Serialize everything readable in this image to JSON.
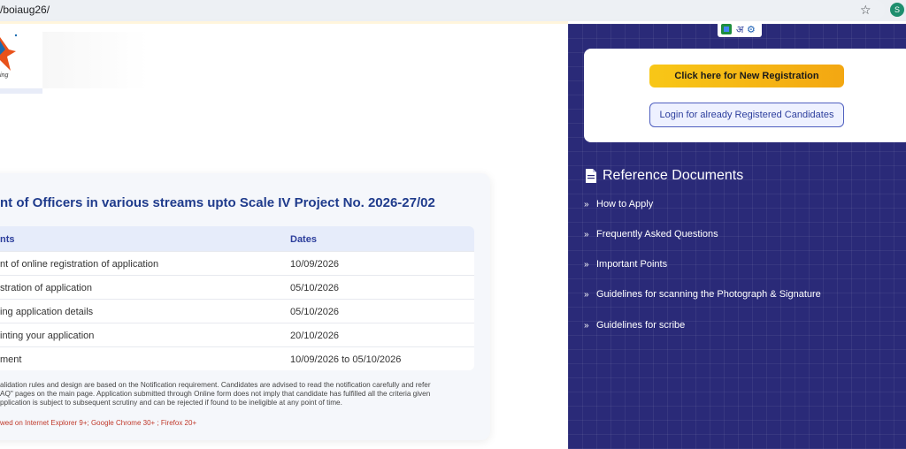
{
  "browser": {
    "url": "/boiaug26/",
    "star_icon": "star-icon",
    "avatar_letter": "S"
  },
  "logo": {
    "tagline": "ing"
  },
  "main": {
    "title": "nt of Officers in various streams upto Scale IV Project No. 2026-27/02",
    "table": {
      "headers": [
        "nts",
        "Dates"
      ],
      "rows": [
        [
          "nt of online registration of application",
          "10/09/2026"
        ],
        [
          "stration of application",
          "05/10/2026"
        ],
        [
          "ing application details",
          "05/10/2026"
        ],
        [
          "inting your application",
          "20/10/2026"
        ],
        [
          "ment",
          "10/09/2026 to 05/10/2026"
        ]
      ]
    },
    "note_lines": [
      "alidation rules and design are based on the Notification requirement. Candidates are advised to read the notification carefully and refer",
      "AQ\" pages on the main page. Application submitted through Online form does not imply that candidate has fulfilled all the criteria given",
      "pplication is subject to subsequent scrutiny and can be rejected if found to be ineligible at any point of time."
    ],
    "browser_note": "wed on Internet Explorer 9+; Google Chrome 30+ ; Firefox 20+"
  },
  "sidebar": {
    "lang_hindi": "अ",
    "new_registration_label": "Click here for New Registration",
    "login_label": "Login for already Registered Candidates",
    "reference_heading": "Reference Documents",
    "items": [
      "How to Apply",
      "Frequently Asked Questions",
      "Important Points",
      "Guidelines for scanning the Photograph & Signature",
      "Guidelines for scribe"
    ]
  },
  "colors": {
    "panel_bg": "#2a2a78",
    "primary_blue": "#1f3b8c",
    "button_yellow": "#f8c717",
    "note_red": "#c0392b"
  }
}
